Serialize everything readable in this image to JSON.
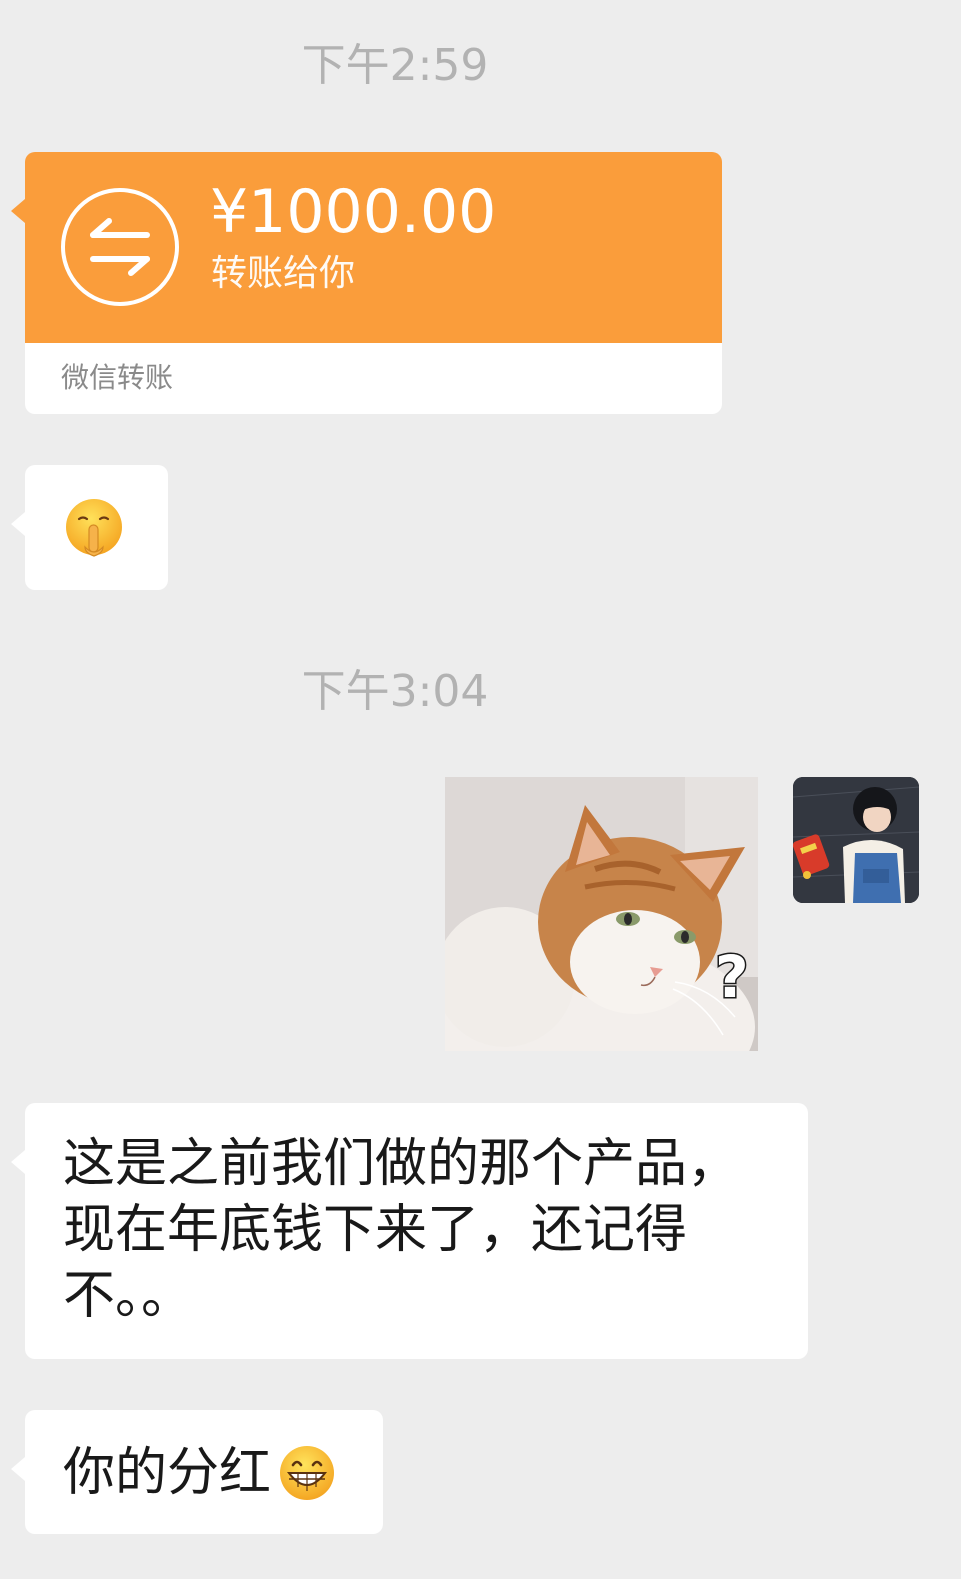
{
  "chat": {
    "timestamps": [
      "下午2:59",
      "下午3:04"
    ],
    "transfer": {
      "amount": "¥1000.00",
      "description": "转账给你",
      "source": "微信转账",
      "accent_color": "#fa9d3b",
      "icon": "transfer-arrows-icon"
    },
    "emoji_message": {
      "icon": "shushing-face-emoji"
    },
    "sticker": {
      "icon": "cat-question-sticker",
      "overlay_text": "?"
    },
    "avatar": {
      "icon": "user-avatar"
    },
    "messages": [
      {
        "text": "这是之前我们做的那个产品，现在年底钱下来了，还记得不。。"
      },
      {
        "text": "你的分红",
        "emoji": "grinning-face-emoji"
      }
    ]
  }
}
